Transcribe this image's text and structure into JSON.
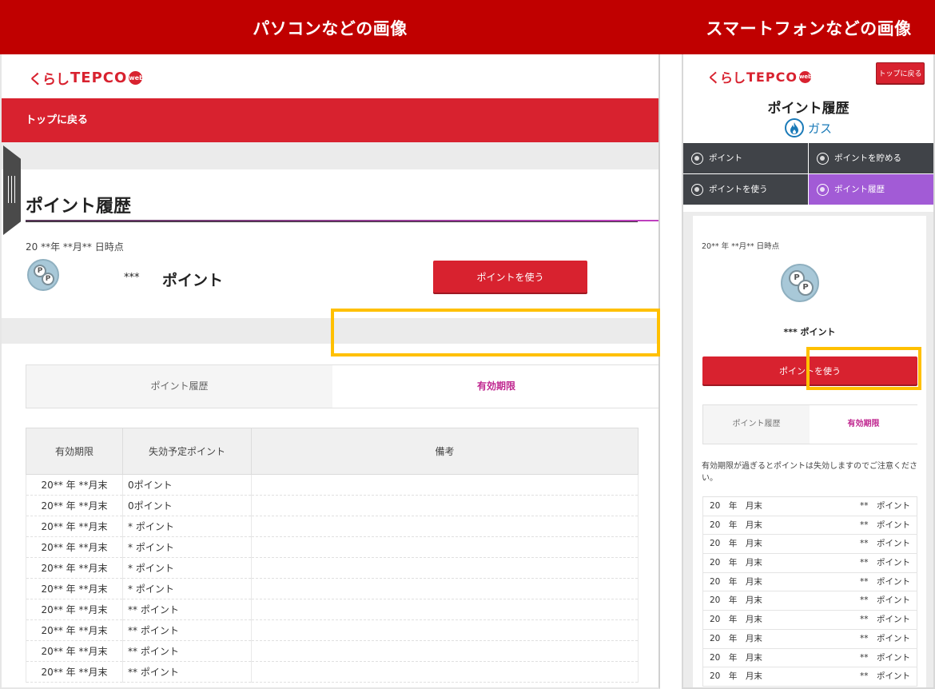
{
  "banner": {
    "pc_title": "パソコンなどの画像",
    "sp_title": "スマートフォンなどの画像",
    "bg_color": "#c00000"
  },
  "logo": {
    "kurashi": "くらし",
    "tepco": "TEPCO",
    "web": "web"
  },
  "pc": {
    "back_link": "トップに戻る",
    "page_title": "ポイント履歴",
    "date": "20 **年 **月** 日時点",
    "coin_icon": "coin-icon",
    "points_value": "***",
    "points_unit": "ポイント",
    "use_button": "ポイントを使う",
    "tabs": [
      {
        "label": "ポイント履歴",
        "active": false
      },
      {
        "label": "有効期限",
        "active": true
      }
    ],
    "table": {
      "headers": [
        "有効期限",
        "失効予定ポイント",
        "備考"
      ],
      "rows": [
        [
          "20** 年 **月末",
          "0ポイント",
          ""
        ],
        [
          "20** 年 **月末",
          "0ポイント",
          ""
        ],
        [
          "20** 年 **月末",
          "* ポイント",
          ""
        ],
        [
          "20** 年 **月末",
          "* ポイント",
          ""
        ],
        [
          "20** 年 **月末",
          "* ポイント",
          ""
        ],
        [
          "20** 年 **月末",
          "* ポイント",
          ""
        ],
        [
          "20** 年 **月末",
          "** ポイント",
          ""
        ],
        [
          "20** 年 **月末",
          "** ポイント",
          ""
        ],
        [
          "20** 年 **月末",
          "** ポイント",
          ""
        ],
        [
          "20** 年 **月末",
          "** ポイント",
          ""
        ]
      ]
    }
  },
  "sp": {
    "top_button": "トップに戻る",
    "page_title": "ポイント履歴",
    "gas_label": "ガス",
    "gas_icon": "flame-icon",
    "menu": [
      {
        "label": "ポイント",
        "icon": "coin-icon",
        "active": false
      },
      {
        "label": "ポイントを貯める",
        "icon": "save-points-icon",
        "active": false
      },
      {
        "label": "ポイントを使う",
        "icon": "use-points-icon",
        "active": false
      },
      {
        "label": "ポイント履歴",
        "icon": "history-icon",
        "active": true
      }
    ],
    "date": "20** 年 **月** 日時点",
    "points": "*** ポイント",
    "use_button": "ポイントを使う",
    "tabs": [
      {
        "label": "ポイント履歴",
        "active": false
      },
      {
        "label": "有効期限",
        "active": true
      }
    ],
    "note": "有効期限が過ぎるとポイントは失効しますのでご注意ください。",
    "rows": [
      {
        "date": "20　年　月末",
        "points": "**　ポイント"
      },
      {
        "date": "20　年　月末",
        "points": "**　ポイント"
      },
      {
        "date": "20　年　月末",
        "points": "**　ポイント"
      },
      {
        "date": "20　年　月末",
        "points": "**　ポイント"
      },
      {
        "date": "20　年　月末",
        "points": "**　ポイント"
      },
      {
        "date": "20　年　月末",
        "points": "**　ポイント"
      },
      {
        "date": "20　年　月末",
        "points": "**　ポイント"
      },
      {
        "date": "20　年　月末",
        "points": "**　ポイント"
      },
      {
        "date": "20　年　月末",
        "points": "**　ポイント"
      },
      {
        "date": "20　年　月末",
        "points": "**　ポイント"
      }
    ]
  },
  "colors": {
    "brand_red": "#d8222f",
    "highlight": "#ffc000",
    "active_tab_text": "#c02890",
    "sp_menu_active": "#a25bd6",
    "sp_menu_bg": "#404348"
  }
}
